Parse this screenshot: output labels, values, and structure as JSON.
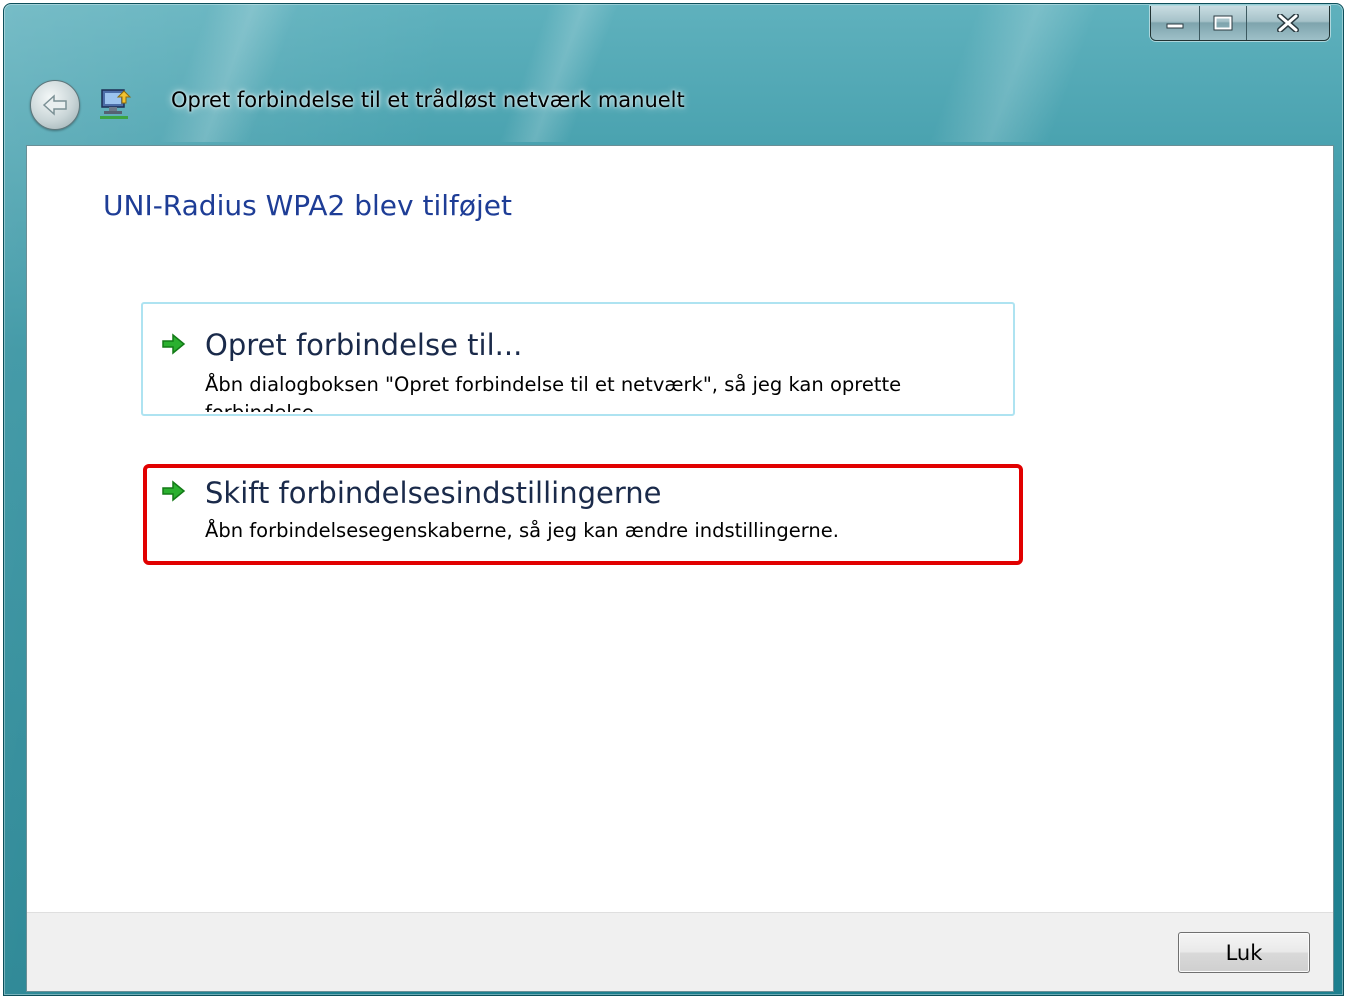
{
  "window": {
    "title": "Opret forbindelse til et trådløst netværk manuelt",
    "caption_buttons": [
      "minimize",
      "maximize",
      "close"
    ]
  },
  "main": {
    "heading": "UNI-Radius WPA2 blev tilføjet",
    "options": [
      {
        "title": "Opret forbindelse til...",
        "description": "Åbn dialogboksen \"Opret forbindelse til et netværk\", så jeg kan oprette forbindelse",
        "icon": "green-arrow-icon"
      },
      {
        "title": "Skift forbindelsesindstillingerne",
        "description": "Åbn forbindelsesegenskaberne, så jeg kan ændre indstillingerne.",
        "icon": "green-arrow-icon",
        "highlighted": true
      }
    ]
  },
  "footer": {
    "close_label": "Luk"
  },
  "colors": {
    "heading": "#1e3d96",
    "highlight": "#e10000",
    "arrow": "#22a22a",
    "titlebar": "#2b8d9c"
  }
}
